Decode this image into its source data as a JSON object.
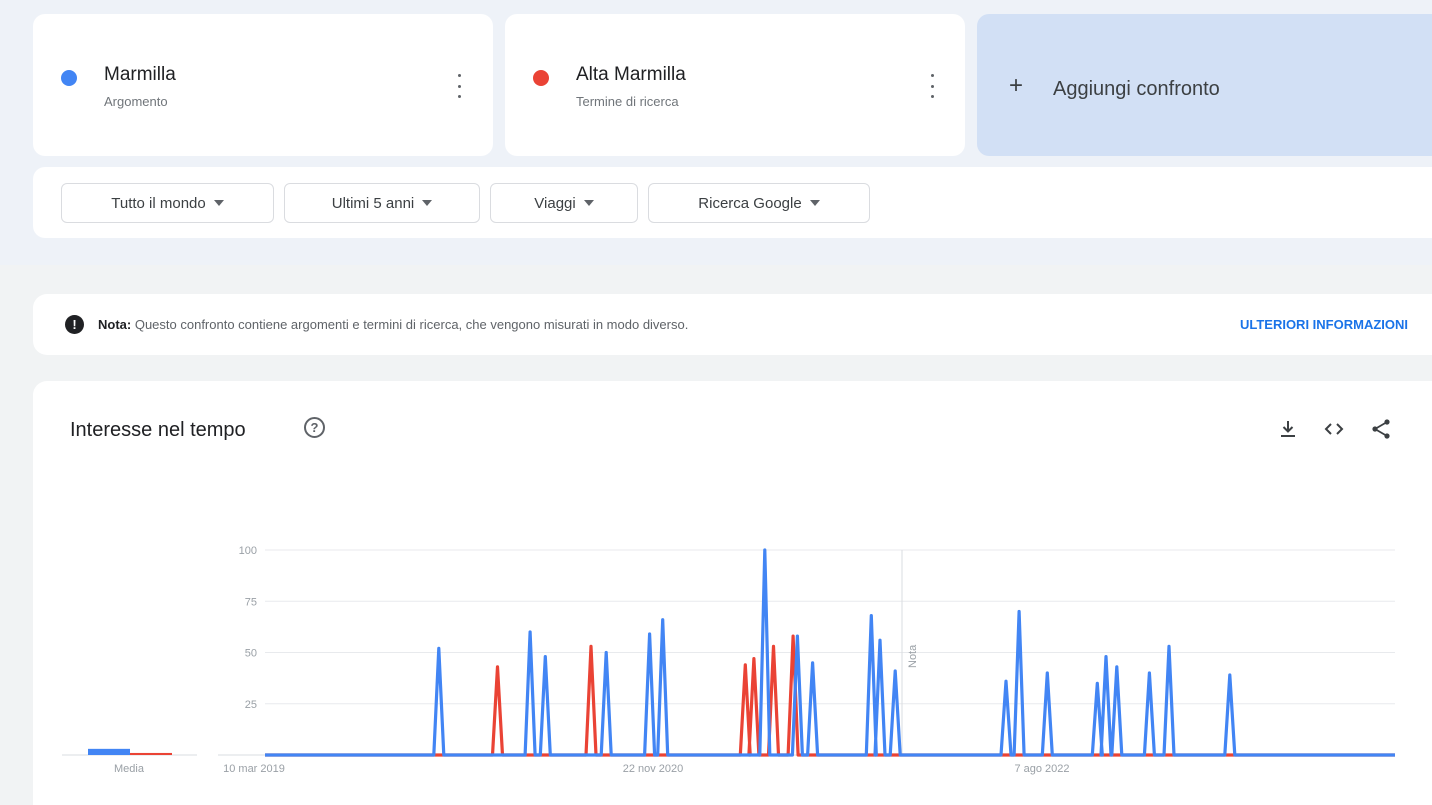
{
  "terms": [
    {
      "name": "Marmilla",
      "type": "Argomento",
      "color": "#4285f4"
    },
    {
      "name": "Alta Marmilla",
      "type": "Termine di ricerca",
      "color": "#ea4335"
    }
  ],
  "add_compare": {
    "plus": "+",
    "label": "Aggiungi confronto"
  },
  "filters": [
    {
      "label": "Tutto il mondo"
    },
    {
      "label": "Ultimi 5 anni"
    },
    {
      "label": "Viaggi"
    },
    {
      "label": "Ricerca Google"
    }
  ],
  "note": {
    "icon": "!",
    "bold": "Nota:",
    "text": " Questo confronto contiene argomenti e termini di ricerca, che vengono misurati in modo diverso.",
    "link": "ULTERIORI INFORMAZIONI"
  },
  "panel": {
    "title": "Interesse nel tempo",
    "help": "?"
  },
  "icons": {
    "download": "download-icon",
    "embed": "embed-icon",
    "share": "share-icon",
    "help": "help-icon",
    "note": "alert-icon"
  },
  "chart_data": {
    "type": "line",
    "x_range": [
      "10 mar 2019",
      "1 mar 2024"
    ],
    "x_tick_labels": [
      "10 mar 2019",
      "22 nov 2020",
      "7 ago 2022"
    ],
    "y_ticks": [
      25,
      50,
      75,
      100
    ],
    "ylim": [
      0,
      100
    ],
    "grid": true,
    "annotation": "Nota",
    "averages_label": "Media",
    "averages": [
      {
        "series": "Marmilla",
        "value": 3
      },
      {
        "series": "Alta Marmilla",
        "value": 1
      }
    ],
    "series": [
      {
        "name": "Marmilla",
        "color": "#4285f4",
        "peaks": [
          {
            "x": 40.0,
            "y": 52
          },
          {
            "x": 61.0,
            "y": 60
          },
          {
            "x": 64.5,
            "y": 48
          },
          {
            "x": 78.5,
            "y": 50
          },
          {
            "x": 88.5,
            "y": 59
          },
          {
            "x": 91.5,
            "y": 66
          },
          {
            "x": 115.0,
            "y": 100
          },
          {
            "x": 122.5,
            "y": 58
          },
          {
            "x": 126.0,
            "y": 45
          },
          {
            "x": 139.5,
            "y": 68
          },
          {
            "x": 141.5,
            "y": 56
          },
          {
            "x": 145.0,
            "y": 41
          },
          {
            "x": 170.5,
            "y": 36
          },
          {
            "x": 173.5,
            "y": 70
          },
          {
            "x": 180.0,
            "y": 40
          },
          {
            "x": 191.5,
            "y": 35
          },
          {
            "x": 193.5,
            "y": 48
          },
          {
            "x": 196.0,
            "y": 43
          },
          {
            "x": 203.5,
            "y": 40
          },
          {
            "x": 208.0,
            "y": 53
          },
          {
            "x": 222.0,
            "y": 39
          }
        ]
      },
      {
        "name": "Alta Marmilla",
        "color": "#ea4335",
        "peaks": [
          {
            "x": 53.5,
            "y": 43
          },
          {
            "x": 75.0,
            "y": 53
          },
          {
            "x": 110.5,
            "y": 44
          },
          {
            "x": 112.5,
            "y": 47
          },
          {
            "x": 117.0,
            "y": 53
          },
          {
            "x": 121.5,
            "y": 58
          }
        ]
      }
    ]
  }
}
